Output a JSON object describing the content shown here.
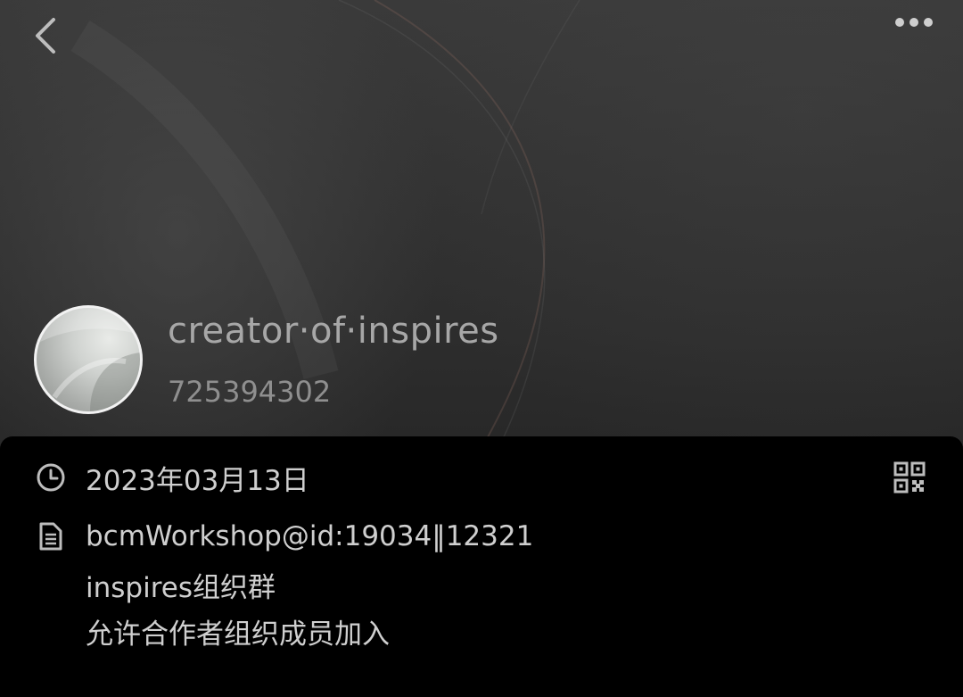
{
  "header": {
    "back_icon": "chevron-left-icon",
    "more_icon": "more-horizontal-icon"
  },
  "profile": {
    "name": "creator·of·inspires",
    "id_number": "725394302",
    "avatar_icon": "avatar-image"
  },
  "info": {
    "date_icon": "clock-icon",
    "date": "2023年03月13日",
    "qr_icon": "qr-code-icon",
    "description_icon": "document-icon",
    "description_lines": [
      "bcmWorkshop@id:19034‖12321",
      "inspires组织群",
      "允许合作者组织成员加入"
    ]
  },
  "colors": {
    "text_primary": "#cfcfcf",
    "name_text": "#a7a7a7",
    "panel_bg": "#000000",
    "cover_bg": "#333333"
  }
}
